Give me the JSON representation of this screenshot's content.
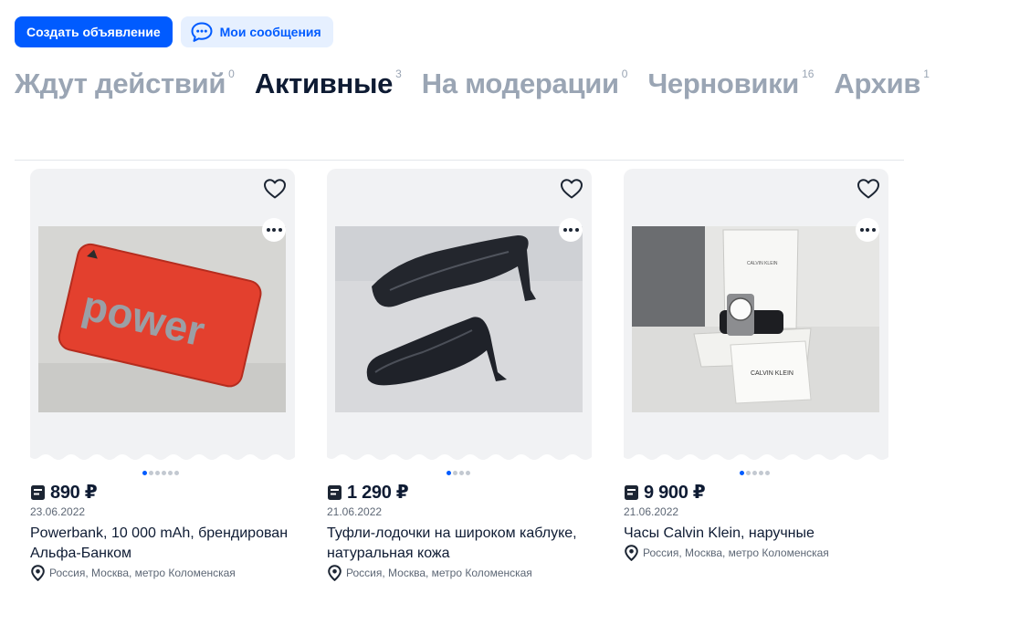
{
  "toolbar": {
    "create_label": "Создать объявление",
    "messages_label": "Мои сообщения"
  },
  "tabs": [
    {
      "label": "Ждут действий",
      "count": "0"
    },
    {
      "label": "Активные",
      "count": "3"
    },
    {
      "label": "На модерации",
      "count": "0"
    },
    {
      "label": "Черновики",
      "count": "16"
    },
    {
      "label": "Архив",
      "count": "1"
    }
  ],
  "active_tab": "Активные",
  "colors": {
    "accent": "#005bff",
    "accent_light": "#e6f0ff",
    "inactive_tab": "#9aa5b4"
  },
  "cards": [
    {
      "price": "890 ₽",
      "date": "23.06.2022",
      "title": "Powerbank, 10 000 mAh, брендирован Альфа-Банком",
      "location": "Россия, Москва, метро Коломенская",
      "photo_text": "power",
      "photo_count": 6,
      "active_photo": 1
    },
    {
      "price": "1 290 ₽",
      "date": "21.06.2022",
      "title": "Туфли-лодочки на широком каблуке, натуральная кожа",
      "location": "Россия, Москва, метро Коломенская",
      "photo_count": 4,
      "active_photo": 1
    },
    {
      "price": "9 900 ₽",
      "date": "21.06.2022",
      "title": "Часы Calvin Klein, наручные",
      "location": "Россия, Москва, метро Коломенская",
      "photo_brand": "CALVIN KLEIN",
      "photo_count": 5,
      "active_photo": 1
    }
  ]
}
